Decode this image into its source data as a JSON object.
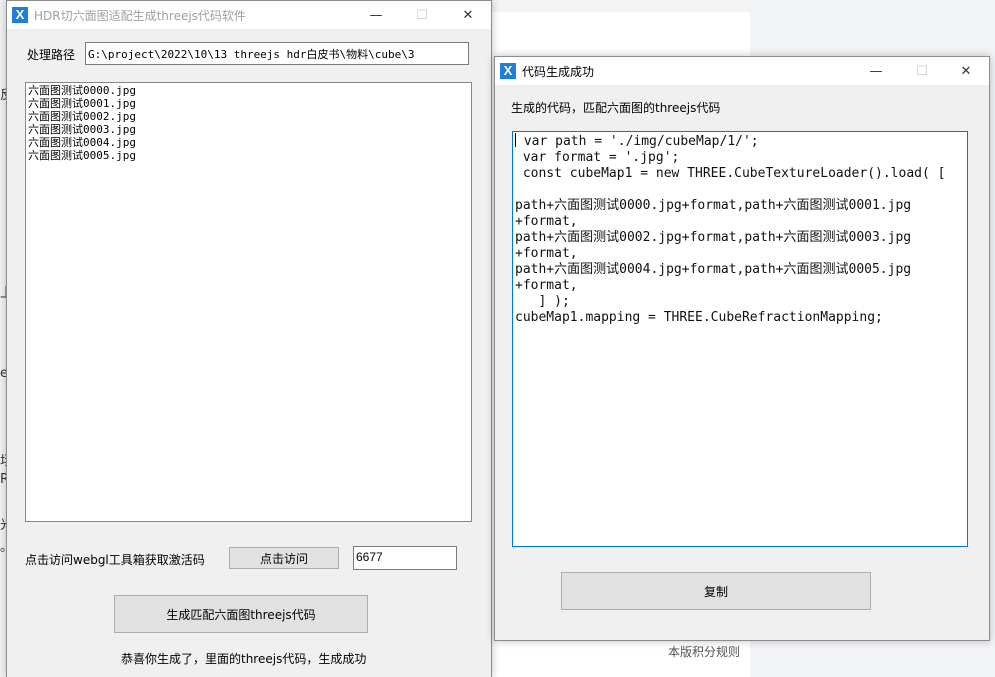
{
  "background": {
    "footer_text": "本版积分规则",
    "left_fragments": [
      "反",
      "上",
      "ee",
      "场",
      "R",
      "光",
      "。"
    ]
  },
  "main_window": {
    "title": "HDR切六面图适配生成threejs代码软件",
    "icon": "app-x-icon",
    "controls": {
      "minimize": "—",
      "maximize": "☐",
      "close": "✕"
    },
    "path_label": "处理路径",
    "path_value": "G:\\project\\2022\\10\\13 threejs hdr白皮书\\物料\\cube\\3",
    "files": [
      "六面图测试0000.jpg",
      "六面图测试0001.jpg",
      "六面图测试0002.jpg",
      "六面图测试0003.jpg",
      "六面图测试0004.jpg",
      "六面图测试0005.jpg"
    ],
    "visit_label": "点击访问webgl工具箱获取激活码",
    "visit_button": "点击访问",
    "activation_code": "6677",
    "generate_button": "生成匹配六面图threejs代码",
    "status": "恭喜你生成了，里面的threejs代码，生成成功"
  },
  "code_window": {
    "title": "代码生成成功",
    "icon": "app-x-icon",
    "controls": {
      "minimize": "—",
      "maximize": "☐",
      "close": "✕"
    },
    "description": "生成的代码，匹配六面图的threejs代码",
    "code": " var path = './img/cubeMap/1/';\n var format = '.jpg';\n const cubeMap1 = new THREE.CubeTextureLoader().load( [\n\npath+六面图测试0000.jpg+format,path+六面图测试0001.jpg\n+format,\npath+六面图测试0002.jpg+format,path+六面图测试0003.jpg\n+format,\npath+六面图测试0004.jpg+format,path+六面图测试0005.jpg\n+format,\n   ] );\ncubeMap1.mapping = THREE.CubeRefractionMapping;",
    "copy_button": "复制"
  }
}
